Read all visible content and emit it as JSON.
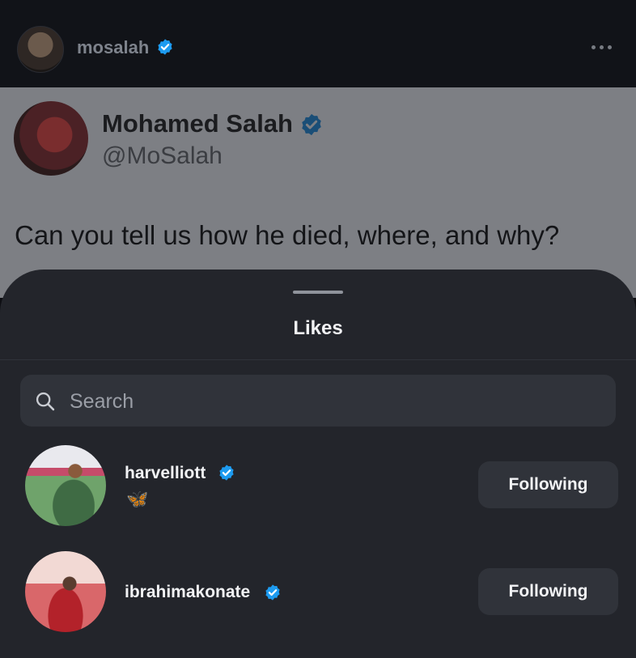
{
  "header": {
    "username": "mosalah",
    "more_icon": "more-icon"
  },
  "post": {
    "display_name": "Mohamed Salah",
    "handle": "@MoSalah",
    "text": "Can you tell us how he died, where, and why?"
  },
  "likes_sheet": {
    "title": "Likes",
    "search": {
      "placeholder": "Search",
      "value": ""
    },
    "users": [
      {
        "username": "harvelliott",
        "bio": "🦋",
        "button_label": "Following",
        "verified": true
      },
      {
        "username": "ibrahimakonate",
        "bio": "",
        "button_label": "Following",
        "verified": true
      }
    ]
  },
  "colors": {
    "verified_badge": "#1d9bf0",
    "sheet_background": "#23252b",
    "button_background": "#30333a"
  }
}
